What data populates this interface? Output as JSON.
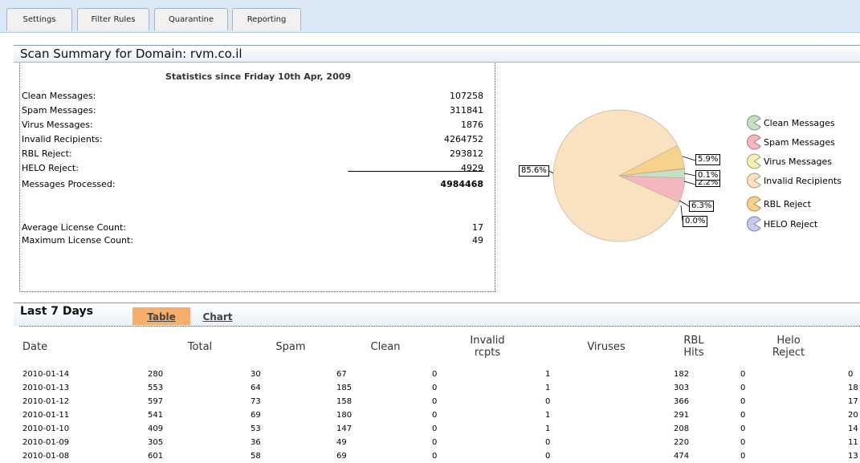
{
  "tabs": [
    "Settings",
    "Filter Rules",
    "Quarantine",
    "Reporting"
  ],
  "summary": {
    "title": "Scan Summary for Domain: rvm.co.il",
    "stats_title": "Statistics since Friday 10th Apr, 2009",
    "rows": [
      {
        "label": "Clean Messages:",
        "value": "107258"
      },
      {
        "label": "Spam Messages:",
        "value": "311841"
      },
      {
        "label": "Virus Messages:",
        "value": "1876"
      },
      {
        "label": "Invalid Recipients:",
        "value": "4264752"
      },
      {
        "label": "RBL Reject:",
        "value": "293812"
      },
      {
        "label": "HELO Reject:",
        "value": "4929"
      }
    ],
    "processed": {
      "label": "Messages Processed:",
      "value": "4984468"
    },
    "avg_license": {
      "label": "Average License Count:",
      "value": "17"
    },
    "max_license": {
      "label": "Maximum License Count:",
      "value": "49"
    }
  },
  "pie": {
    "labels": {
      "invalid": "85.6%",
      "rbl": "5.9%",
      "virus": "0.1%",
      "clean": "2.2%",
      "spam": "6.3%",
      "helo": "0.0%"
    },
    "colors": {
      "clean": "#c6e0c6",
      "spam": "#f2b8bd",
      "virus": "#f5f1b5",
      "invalid": "#f9e2c0",
      "rbl": "#f7d28c",
      "helo": "#c9c9ef"
    }
  },
  "legend": [
    "Clean Messages",
    "Spam Messages",
    "Virus Messages",
    "Invalid Recipients",
    "RBL Reject",
    "HELO Reject"
  ],
  "last7": {
    "title": "Last 7 Days",
    "tab_table": "Table",
    "tab_chart": "Chart",
    "headers": {
      "date": "Date",
      "total": "Total",
      "spam": "Spam",
      "clean": "Clean",
      "invalid_1": "Invalid",
      "invalid_2": "rcpts",
      "viruses": "Viruses",
      "rbl_1": "RBL",
      "rbl_2": "Hits",
      "helo_1": "Helo",
      "helo_2": "Reject"
    },
    "rows": [
      [
        "2010-01-14",
        "280",
        "30",
        "67",
        "0",
        "1",
        "182",
        "0",
        "0"
      ],
      [
        "2010-01-13",
        "553",
        "64",
        "185",
        "0",
        "1",
        "303",
        "0",
        "18"
      ],
      [
        "2010-01-12",
        "597",
        "73",
        "158",
        "0",
        "0",
        "366",
        "0",
        "17"
      ],
      [
        "2010-01-11",
        "541",
        "69",
        "180",
        "0",
        "1",
        "291",
        "0",
        "20"
      ],
      [
        "2010-01-10",
        "409",
        "53",
        "147",
        "0",
        "1",
        "208",
        "0",
        "14"
      ],
      [
        "2010-01-09",
        "305",
        "36",
        "49",
        "0",
        "0",
        "220",
        "0",
        "11"
      ],
      [
        "2010-01-08",
        "601",
        "58",
        "69",
        "0",
        "0",
        "474",
        "0",
        "13"
      ]
    ]
  }
}
